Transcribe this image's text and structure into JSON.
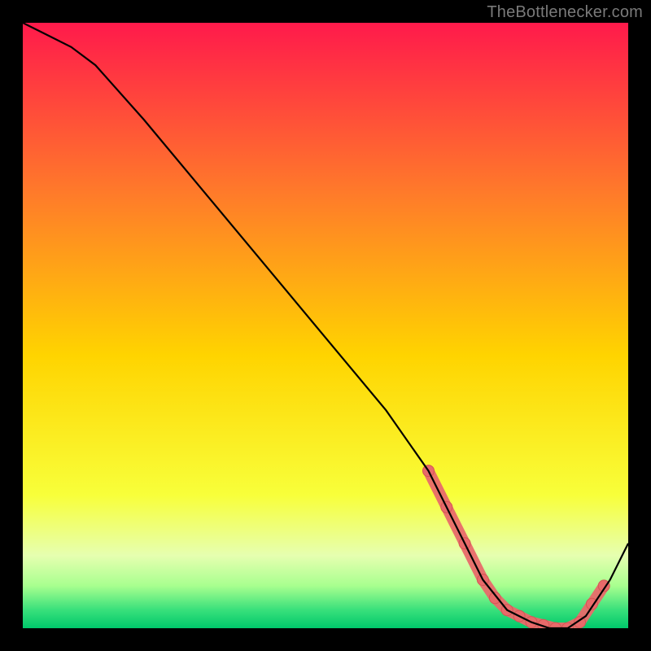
{
  "attribution": "TheBottlenecker.com",
  "colors": {
    "gradient_top": "#ff1a4b",
    "gradient_mid1": "#ff7a2a",
    "gradient_mid2": "#ffd400",
    "gradient_mid3": "#f8ff3a",
    "gradient_bottom_band1": "#e6ffb0",
    "gradient_bottom_band2": "#a8ff8f",
    "gradient_bottom_band3": "#38e07b",
    "gradient_bottom_edge": "#00c86b",
    "curve": "#000000",
    "marker_fill": "#e86a6a",
    "marker_stroke": "#d65555",
    "frame": "#000000"
  },
  "chart_data": {
    "type": "line",
    "title": "",
    "xlabel": "",
    "ylabel": "",
    "xlim": [
      0,
      100
    ],
    "ylim": [
      0,
      100
    ],
    "series": [
      {
        "name": "curve",
        "x": [
          0,
          4,
          8,
          12,
          20,
          30,
          40,
          50,
          60,
          67,
          70,
          73,
          76,
          80,
          84,
          87,
          90,
          93,
          97,
          100
        ],
        "y": [
          100,
          98,
          96,
          93,
          84,
          72,
          60,
          48,
          36,
          26,
          20,
          14,
          8,
          3,
          1,
          0,
          0,
          2,
          8,
          14
        ]
      }
    ],
    "markers": {
      "name": "highlight-points",
      "x": [
        67,
        70,
        73,
        76,
        78,
        80,
        82,
        84,
        86,
        88,
        90,
        92,
        94,
        96
      ],
      "y": [
        26,
        20,
        14,
        8,
        5,
        3,
        2,
        1,
        0.5,
        0,
        0,
        1,
        4,
        7
      ]
    }
  }
}
